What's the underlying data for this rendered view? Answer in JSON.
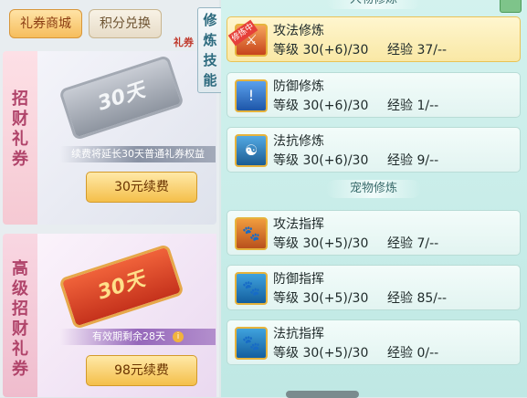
{
  "shop": {
    "tabs": [
      {
        "label": "礼券商城",
        "active": true
      },
      {
        "label": "积分兑换",
        "active": false
      }
    ],
    "badge_text": "礼券",
    "cards": [
      {
        "side_label": "招财礼券",
        "ticket_text": "30天",
        "description": "续费将延长30天普通礼券权益",
        "button_label": "30元续费"
      },
      {
        "side_label": "高级招财礼券",
        "ticket_text": "30天",
        "description": "有效期剩余28天",
        "button_label": "98元续费"
      }
    ]
  },
  "skill_panel": {
    "vertical_title": "修炼技能",
    "character_section": {
      "title": "人物修炼",
      "rows": [
        {
          "name": "攻法修炼",
          "level_label": "等级",
          "level": "30(+6)/30",
          "exp_label": "经验",
          "exp": "37/--",
          "selected": true,
          "badge": "修炼中",
          "icon": "sword-icon"
        },
        {
          "name": "防御修炼",
          "level_label": "等级",
          "level": "30(+6)/30",
          "exp_label": "经验",
          "exp": "1/--",
          "selected": false,
          "icon": "shield-icon"
        },
        {
          "name": "法抗修炼",
          "level_label": "等级",
          "level": "30(+6)/30",
          "exp_label": "经验",
          "exp": "9/--",
          "selected": false,
          "icon": "yinyang-icon"
        }
      ]
    },
    "pet_section": {
      "title": "宠物修炼",
      "rows": [
        {
          "name": "攻法指挥",
          "level_label": "等级",
          "level": "30(+5)/30",
          "exp_label": "经验",
          "exp": "7/--",
          "icon": "paw-attack-icon"
        },
        {
          "name": "防御指挥",
          "level_label": "等级",
          "level": "30(+5)/30",
          "exp_label": "经验",
          "exp": "85/--",
          "icon": "paw-defense-icon"
        },
        {
          "name": "法抗指挥",
          "level_label": "等级",
          "level": "30(+5)/30",
          "exp_label": "经验",
          "exp": "0/--",
          "icon": "paw-resist-icon"
        }
      ]
    }
  }
}
